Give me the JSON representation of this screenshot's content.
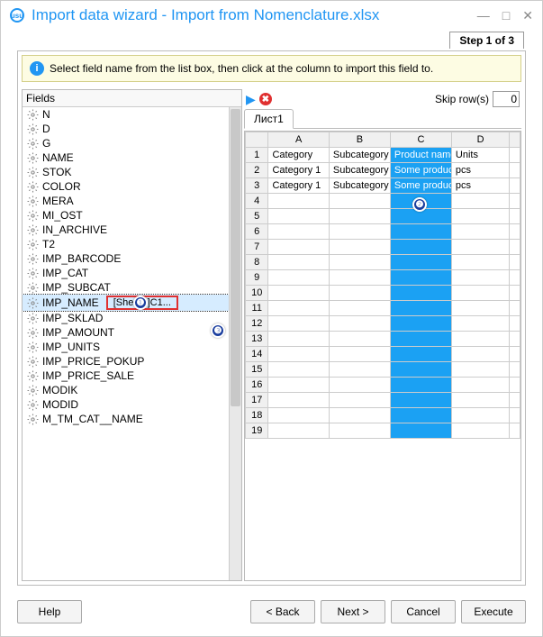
{
  "window": {
    "title": "Import data wizard - Import from Nomenclature.xlsx"
  },
  "step": "Step 1 of 3",
  "info": "Select field name from the list box, then click at the column to import this field to.",
  "fields_header": "Fields",
  "fields": [
    {
      "name": "N"
    },
    {
      "name": "D"
    },
    {
      "name": "G"
    },
    {
      "name": "NAME"
    },
    {
      "name": "STOK"
    },
    {
      "name": "COLOR"
    },
    {
      "name": "MERA"
    },
    {
      "name": "MI_OST"
    },
    {
      "name": "IN_ARCHIVE"
    },
    {
      "name": "T2"
    },
    {
      "name": "IMP_BARCODE"
    },
    {
      "name": "IMP_CAT"
    },
    {
      "name": "IMP_SUBCAT"
    },
    {
      "name": "IMP_NAME",
      "selected": true,
      "mapping": "[Sheet1]C1..."
    },
    {
      "name": "IMP_SKLAD"
    },
    {
      "name": "IMP_AMOUNT"
    },
    {
      "name": "IMP_UNITS"
    },
    {
      "name": "IMP_PRICE_POKUP"
    },
    {
      "name": "IMP_PRICE_SALE"
    },
    {
      "name": "MODIK"
    },
    {
      "name": "MODID"
    },
    {
      "name": "M_TM_CAT__NAME"
    }
  ],
  "skip_label": "Skip row(s)",
  "skip_value": "0",
  "sheet_tab": "Лист1",
  "grid": {
    "columns": [
      "A",
      "B",
      "C",
      "D"
    ],
    "rows": [
      {
        "n": "1",
        "a": "Category",
        "b": "Subcategory",
        "c": "Product name",
        "d": "Units"
      },
      {
        "n": "2",
        "a": "Category 1",
        "b": "Subcategory",
        "c": "Some produc",
        "d": "pcs"
      },
      {
        "n": "3",
        "a": "Category 1",
        "b": "Subcategory",
        "c": "Some produc",
        "d": "pcs"
      },
      {
        "n": "4"
      },
      {
        "n": "5"
      },
      {
        "n": "6"
      },
      {
        "n": "7"
      },
      {
        "n": "8"
      },
      {
        "n": "9"
      },
      {
        "n": "10"
      },
      {
        "n": "11"
      },
      {
        "n": "12"
      },
      {
        "n": "13"
      },
      {
        "n": "14"
      },
      {
        "n": "15"
      },
      {
        "n": "16"
      },
      {
        "n": "17"
      },
      {
        "n": "18"
      },
      {
        "n": "19"
      }
    ]
  },
  "buttons": {
    "help": "Help",
    "back": "< Back",
    "next": "Next >",
    "cancel": "Cancel",
    "execute": "Execute"
  },
  "callouts": {
    "one": "❶",
    "two": "❷",
    "three": "❸"
  }
}
